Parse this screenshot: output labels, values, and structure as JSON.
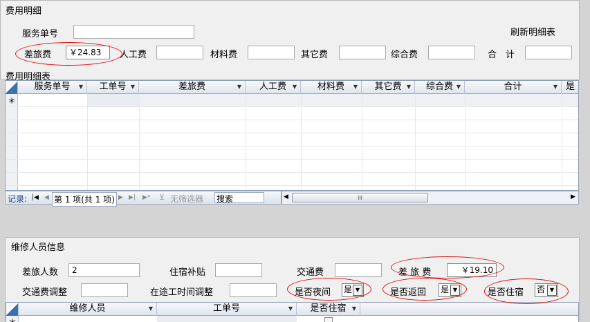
{
  "top_panel": {
    "title": "费用明细",
    "service_no_label": "服务单号",
    "service_no_value": "",
    "refresh_button": "刷新明细表",
    "fields": [
      {
        "label": "差旅费",
        "value": "￥24.83"
      },
      {
        "label": "人工费",
        "value": ""
      },
      {
        "label": "材料费",
        "value": ""
      },
      {
        "label": "其它费",
        "value": ""
      },
      {
        "label": "综合费",
        "value": ""
      },
      {
        "label": "合　计",
        "value": ""
      }
    ]
  },
  "detail_table": {
    "title": "费用明细表",
    "columns": [
      "服务单号",
      "工单号",
      "差旅费",
      "人工费",
      "材料费",
      "其它费",
      "综合费",
      "合计",
      "是"
    ],
    "new_row_marker": "＊",
    "navigator": {
      "record_label": "记录:",
      "position": "第 1 项(共 1 项)",
      "filter_label": "无筛选器",
      "search_label": "搜索"
    },
    "scroll_thumb": "III"
  },
  "repair_panel": {
    "title": "维修人员信息",
    "travelers_label": "差旅人数",
    "travelers_value": "2",
    "lodging_label": "住宿补贴",
    "lodging_value": "",
    "transport_label": "交通费",
    "transport_value": "",
    "travel_fee_label": "差 旅 费",
    "travel_fee_value": "￥19.10",
    "transport_adj_label": "交通费调整",
    "transport_adj_value": "",
    "transit_time_label": "在途工时间调整",
    "transit_time_value": "",
    "night_label": "是否夜间",
    "night_value": "是",
    "return_label": "是否返回",
    "return_value": "是",
    "stay_label": "是否住宿",
    "stay_value": "否",
    "columns": [
      "维修人员",
      "工单号",
      "是否住宿"
    ],
    "new_row_marker": "＊"
  },
  "colors": {
    "annotation": "#e01010",
    "grid_border": "#8e9eb4"
  }
}
